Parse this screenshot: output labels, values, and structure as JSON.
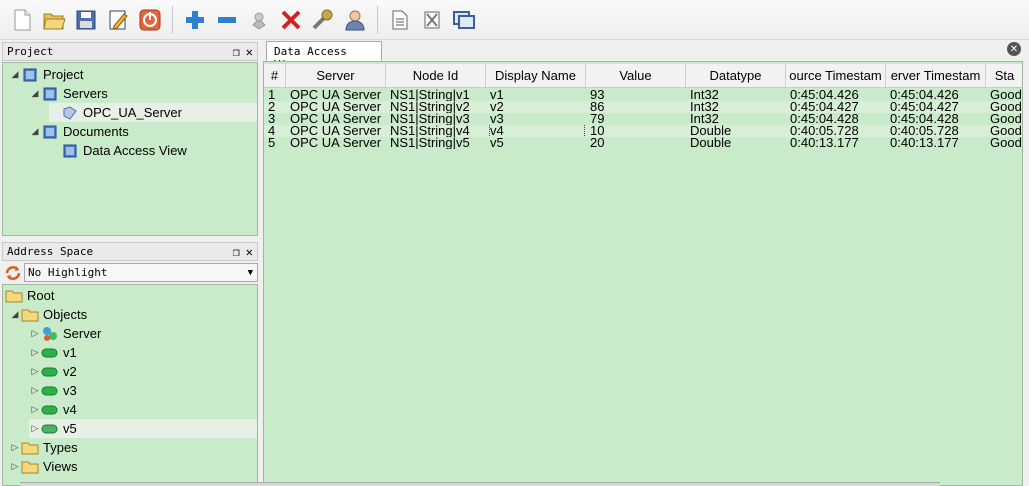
{
  "toolbar": {
    "buttons": [
      {
        "icon": "new-file-icon"
      },
      {
        "icon": "open-folder-icon"
      },
      {
        "icon": "save-icon"
      },
      {
        "icon": "edit-icon"
      },
      {
        "icon": "power-icon"
      },
      {
        "icon": "add-icon"
      },
      {
        "icon": "remove-icon"
      },
      {
        "icon": "connect-icon"
      },
      {
        "icon": "delete-icon"
      },
      {
        "icon": "settings-wrench-icon"
      },
      {
        "icon": "user-icon"
      },
      {
        "icon": "document-icon"
      },
      {
        "icon": "clear-icon"
      },
      {
        "icon": "window-icon"
      }
    ]
  },
  "project_panel": {
    "title": "Project",
    "tree": [
      {
        "label": "Project",
        "level": 0,
        "expanded": true,
        "icon": "project-icon"
      },
      {
        "label": "Servers",
        "level": 1,
        "expanded": true,
        "icon": "folder-icon"
      },
      {
        "label": "OPC_UA_Server",
        "level": 2,
        "selected": true,
        "icon": "server-icon"
      },
      {
        "label": "Documents",
        "level": 1,
        "expanded": true,
        "icon": "folder-icon"
      },
      {
        "label": "Data Access View",
        "level": 2,
        "icon": "document-icon"
      }
    ]
  },
  "address_panel": {
    "title": "Address Space",
    "highlight_select": "No Highlight",
    "tree": [
      {
        "label": "Root",
        "level": 0,
        "icon": "folder-icon",
        "arrow": ""
      },
      {
        "label": "Objects",
        "level": 1,
        "icon": "folder-icon",
        "arrow": "expanded"
      },
      {
        "label": "Server",
        "level": 2,
        "icon": "server-object-icon",
        "arrow": "collapsed"
      },
      {
        "label": "v1",
        "level": 2,
        "icon": "variable-icon",
        "arrow": "collapsed"
      },
      {
        "label": "v2",
        "level": 2,
        "icon": "variable-icon",
        "arrow": "collapsed"
      },
      {
        "label": "v3",
        "level": 2,
        "icon": "variable-icon",
        "arrow": "collapsed"
      },
      {
        "label": "v4",
        "level": 2,
        "icon": "variable-icon",
        "arrow": "collapsed"
      },
      {
        "label": "v5",
        "level": 2,
        "icon": "variable-icon",
        "arrow": "collapsed",
        "selected": true
      },
      {
        "label": "Types",
        "level": 1,
        "icon": "folder-icon",
        "arrow": "collapsed"
      },
      {
        "label": "Views",
        "level": 1,
        "icon": "folder-icon",
        "arrow": "collapsed"
      }
    ]
  },
  "main": {
    "tab_label": "Data Access View",
    "columns": [
      "#",
      "Server",
      "Node Id",
      "Display Name",
      "Value",
      "Datatype",
      "ource Timestam",
      "erver Timestam",
      "Sta"
    ],
    "rows": [
      [
        "1",
        "OPC UA Server",
        "NS1|String|v1",
        "v1",
        "93",
        "Int32",
        "0:45:04.426",
        "0:45:04.426",
        "Good"
      ],
      [
        "2",
        "OPC UA Server",
        "NS1|String|v2",
        "v2",
        "86",
        "Int32",
        "0:45:04.427",
        "0:45:04.427",
        "Good"
      ],
      [
        "3",
        "OPC UA Server",
        "NS1|String|v3",
        "v3",
        "79",
        "Int32",
        "0:45:04.428",
        "0:45:04.428",
        "Good"
      ],
      [
        "4",
        "OPC UA Server",
        "NS1|String|v4",
        "v4",
        "10",
        "Double",
        "0:40:05.728",
        "0:40:05.728",
        "Good"
      ],
      [
        "5",
        "OPC UA Server",
        "NS1|String|v5",
        "v5",
        "20",
        "Double",
        "0:40:13.177",
        "0:40:13.177",
        "Good"
      ]
    ]
  }
}
